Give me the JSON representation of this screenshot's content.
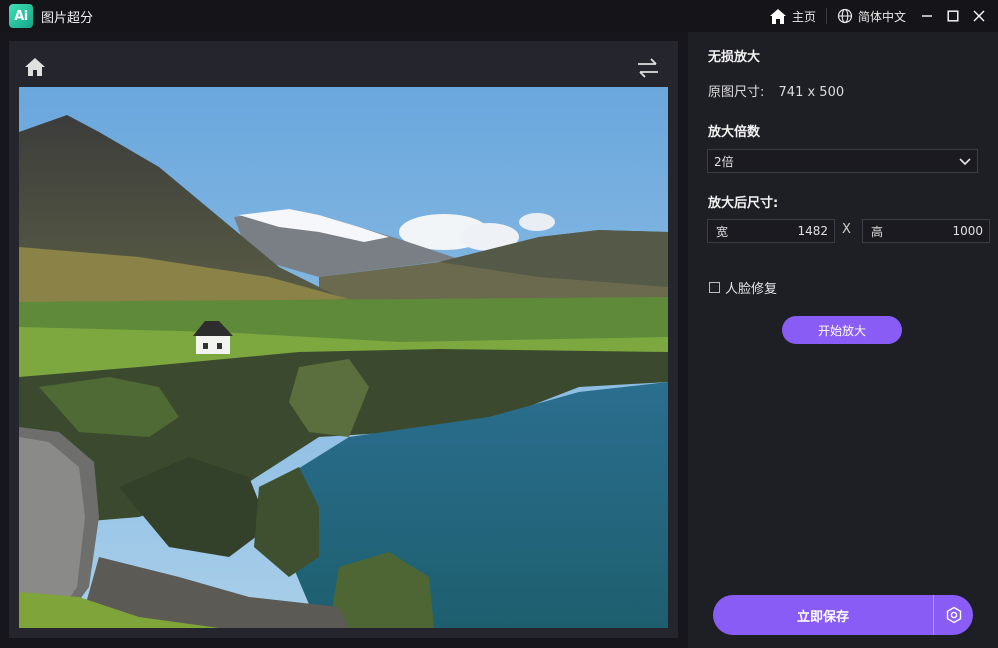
{
  "titlebar": {
    "app_logo": "Ai",
    "app_title": "图片超分",
    "home_label": "主页",
    "language_label": "简体中文"
  },
  "icons": {
    "home": "home-icon",
    "globe": "globe-icon",
    "swap": "swap-icon",
    "minimize": "minimize-icon",
    "maximize": "maximize-icon",
    "close": "close-icon",
    "chevron": "chevron-down-icon",
    "settings": "hexagon-settings-icon"
  },
  "panel": {
    "lossless_title": "无损放大",
    "original_size_label": "原图尺寸:",
    "original_size_value": "741 x 500",
    "scale_title": "放大倍数",
    "scale_selected": "2倍",
    "output_size_title": "放大后尺寸:",
    "width_label": "宽",
    "width_value": "1482",
    "size_separator": "X",
    "height_label": "高",
    "height_value": "1000",
    "face_repair_label": "人脸修复",
    "face_repair_checked": false,
    "start_button": "开始放大",
    "save_button": "立即保存"
  },
  "colors": {
    "accent": "#8a5cf6",
    "logo": "#2fc9a0"
  }
}
